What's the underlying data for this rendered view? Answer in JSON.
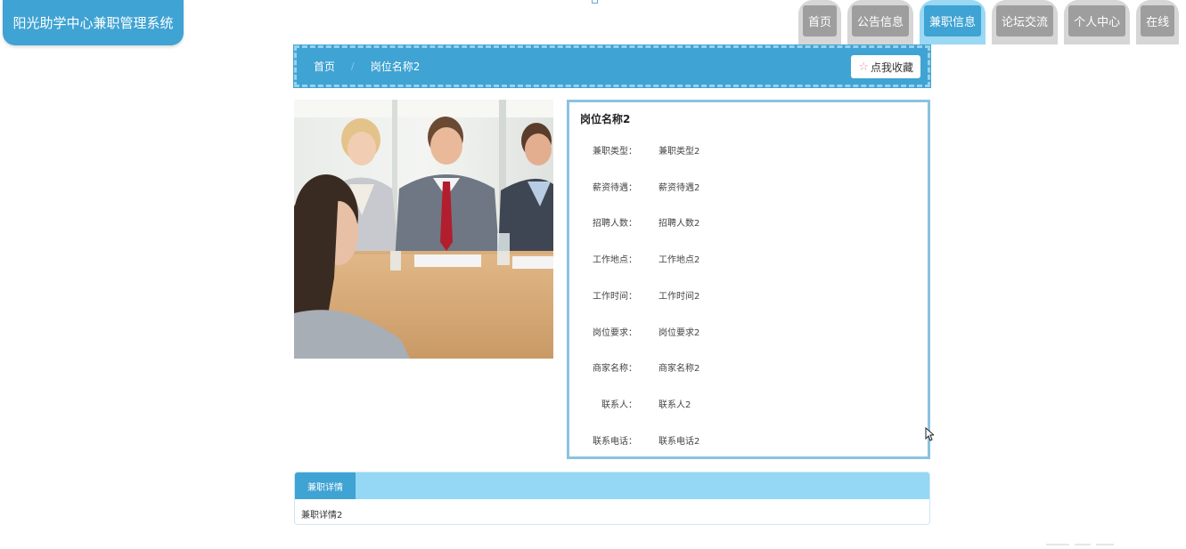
{
  "app": {
    "title": "阳光助学中心兼职管理系统"
  },
  "nav": {
    "items": [
      {
        "label": "首页",
        "active": false
      },
      {
        "label": "公告信息",
        "active": false
      },
      {
        "label": "兼职信息",
        "active": true
      },
      {
        "label": "论坛交流",
        "active": false
      },
      {
        "label": "个人中心",
        "active": false
      },
      {
        "label": "在线",
        "active": false
      }
    ]
  },
  "breadcrumb": {
    "home": "首页",
    "separator": "/",
    "current": "岗位名称2"
  },
  "favorite": {
    "icon": "star-icon",
    "label": "点我收藏"
  },
  "info": {
    "title": "岗位名称2",
    "rows": [
      {
        "label": "兼职类型：",
        "value": "兼职类型2"
      },
      {
        "label": "薪资待遇：",
        "value": "薪资待遇2"
      },
      {
        "label": "招聘人数：",
        "value": "招聘人数2"
      },
      {
        "label": "工作地点：",
        "value": "工作地点2"
      },
      {
        "label": "工作时间：",
        "value": "工作时间2"
      },
      {
        "label": "岗位要求：",
        "value": "岗位要求2"
      },
      {
        "label": "商家名称：",
        "value": "商家名称2"
      },
      {
        "label": "联系人：",
        "value": "联系人2"
      },
      {
        "label": "联系电话：",
        "value": "联系电话2"
      }
    ]
  },
  "detail": {
    "tab": "兼职详情",
    "content": "兼职详情2"
  },
  "colors": {
    "accent": "#3fa3d3",
    "accent_light": "#94d8f5",
    "nav_inactive": "#9e9e9e"
  }
}
